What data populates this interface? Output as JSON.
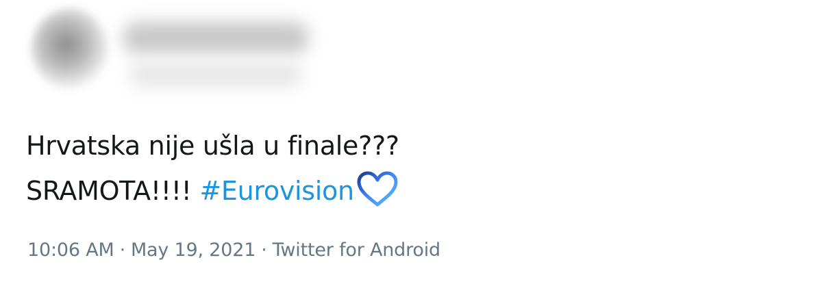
{
  "tweet": {
    "line1": "Hrvatska nije ušla u finale???",
    "line2": "SRAMOTA!!!! ",
    "hashtag": "#Eurovision",
    "emoji": "eurovision-heart-icon",
    "time": "10:06 AM",
    "separator": "·",
    "date": "May 19, 2021",
    "source": "Twitter for Android"
  },
  "colors": {
    "text": "#14171a",
    "hashtag": "#1b95e0",
    "meta": "#657786",
    "heart_gradient": [
      "#1e3a8a",
      "#3b82f6",
      "#60c4f0"
    ]
  }
}
